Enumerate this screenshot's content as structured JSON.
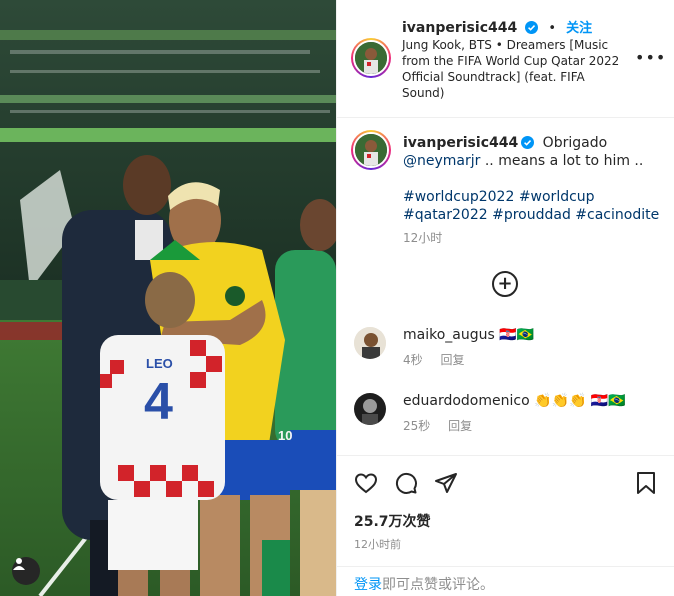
{
  "post": {
    "author": "ivanperisic444",
    "follow_label": "关注",
    "dot": "•",
    "song": "Jung Kook, BTS • Dreamers [Music from the FIFA World Cup Qatar 2022 Official Soundtrack] (feat. FIFA Sound)",
    "more_label": "•••"
  },
  "caption": {
    "author": "ivanperisic444",
    "text_1": "Obrigado",
    "mention": "@neymarjr",
    "text_2": " .. means a lot to him ..",
    "hashtags_line1": "#worldcup2022 #worldcup",
    "hashtags_line2": "#qatar2022 #prouddad #cacinodite",
    "time": "12小时",
    "load_more": "+"
  },
  "comments": [
    {
      "user": "maiko_augus",
      "text": "🇭🇷🇧🇷",
      "time": "4秒",
      "reply": "回复"
    },
    {
      "user": "eduardodomenico",
      "text": "👏👏👏 🇭🇷🇧🇷",
      "time": "25秒",
      "reply": "回复"
    }
  ],
  "stats": {
    "likes": "25.7万次赞",
    "time": "12小时前"
  },
  "login_bar": {
    "login": "登录",
    "rest": "即可点赞或评论。"
  },
  "media": {
    "jersey_name": "LEO",
    "jersey_number": "4",
    "sleeve_number": "10"
  },
  "colors": {
    "follow_blue": "#0095f6",
    "link_blue": "#00376b",
    "brazil_yellow": "#f2d21f",
    "pitch_green": "#2c6a2e"
  }
}
